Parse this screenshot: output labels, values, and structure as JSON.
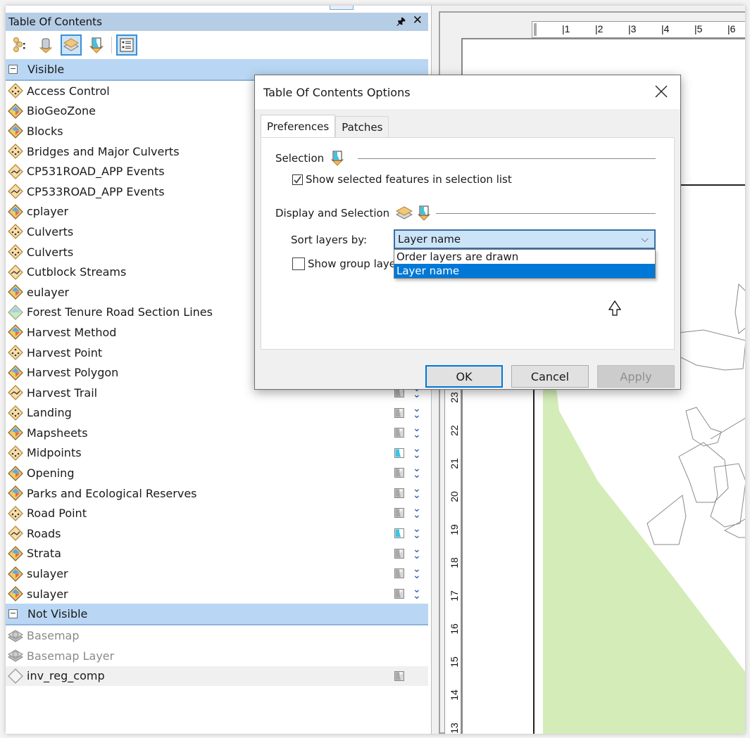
{
  "toc": {
    "title": "Table Of Contents",
    "pin_icon": "pin-icon",
    "close_icon": "close-icon",
    "toolbar": [
      {
        "name": "list-by-drawing-order",
        "icon": "drawing-order-icon",
        "active": false
      },
      {
        "name": "list-by-source",
        "icon": "database-icon",
        "active": false
      },
      {
        "name": "list-by-visibility",
        "icon": "layers-icon",
        "active": true
      },
      {
        "name": "list-by-selection",
        "icon": "selection-icon",
        "active": false
      },
      {
        "name": "options",
        "icon": "options-list-icon",
        "active": true
      }
    ],
    "groups": {
      "visible": {
        "label": "Visible",
        "layers": [
          {
            "name": "Access Control",
            "type": "point"
          },
          {
            "name": "BioGeoZone",
            "type": "polygon"
          },
          {
            "name": "Blocks",
            "type": "polygon"
          },
          {
            "name": "Bridges and Major Culverts",
            "type": "point"
          },
          {
            "name": "CP531ROAD_APP Events",
            "type": "line"
          },
          {
            "name": "CP533ROAD_APP Events",
            "type": "line"
          },
          {
            "name": "cplayer",
            "type": "polygon"
          },
          {
            "name": "Culverts",
            "type": "point"
          },
          {
            "name": "Culverts",
            "type": "point"
          },
          {
            "name": "Cutblock Streams",
            "type": "line"
          },
          {
            "name": "eulayer",
            "type": "polygon"
          },
          {
            "name": "Forest Tenure Road Section Lines",
            "type": "raster"
          },
          {
            "name": "Harvest Method",
            "type": "polygon"
          },
          {
            "name": "Harvest Point",
            "type": "point"
          },
          {
            "name": "Harvest Polygon",
            "type": "polygon"
          },
          {
            "name": "Harvest Trail",
            "type": "line",
            "selectable": false,
            "controls": true
          },
          {
            "name": "Landing",
            "type": "point",
            "selectable": false,
            "controls": true
          },
          {
            "name": "Mapsheets",
            "type": "polygon",
            "selectable": false,
            "controls": true
          },
          {
            "name": "Midpoints",
            "type": "point",
            "selectable": true,
            "controls": true
          },
          {
            "name": "Opening",
            "type": "polygon",
            "selectable": false,
            "controls": true
          },
          {
            "name": "Parks and Ecological Reserves",
            "type": "polygon",
            "selectable": false,
            "controls": true
          },
          {
            "name": "Road Point",
            "type": "point",
            "selectable": false,
            "controls": true
          },
          {
            "name": "Roads",
            "type": "line",
            "selectable": true,
            "controls": true
          },
          {
            "name": "Strata",
            "type": "polygon",
            "selectable": false,
            "controls": true
          },
          {
            "name": "sulayer",
            "type": "polygon",
            "selectable": false,
            "controls": true
          },
          {
            "name": "sulayer",
            "type": "polygon",
            "selectable": false,
            "controls": true
          }
        ]
      },
      "not_visible": {
        "label": "Not Visible",
        "layers": [
          {
            "name": "Basemap",
            "type": "basemap",
            "dim": true
          },
          {
            "name": "Basemap Layer",
            "type": "basemap",
            "dim": true
          },
          {
            "name": "inv_reg_comp",
            "type": "empty",
            "selectable": false,
            "highlighted": true,
            "controls_sel_only": true
          }
        ]
      }
    }
  },
  "layout_view": {
    "h_ruler_ticks": [
      "1",
      "2",
      "3",
      "4",
      "5",
      "6"
    ],
    "v_ruler_ticks": [
      "23",
      "22",
      "21",
      "20",
      "19",
      "18",
      "17",
      "16",
      "15",
      "14",
      "13"
    ],
    "map_fill_color": "#d3ecb8"
  },
  "dialog": {
    "title": "Table Of Contents Options",
    "tabs": [
      {
        "label": "Preferences",
        "active": true
      },
      {
        "label": "Patches",
        "active": false
      }
    ],
    "selection_section": {
      "label": "Selection",
      "checkbox_label": "Show selected features in selection list",
      "checked": true
    },
    "display_section": {
      "label": "Display and Selection",
      "sort_label": "Sort layers by:",
      "sort_value": "Layer name",
      "options": [
        "Order layers are drawn",
        "Layer name"
      ],
      "selected_option": "Layer name",
      "group_checkbox_label": "Show group layers",
      "group_checked": false
    },
    "buttons": {
      "ok": "OK",
      "cancel": "Cancel",
      "apply": "Apply"
    }
  }
}
